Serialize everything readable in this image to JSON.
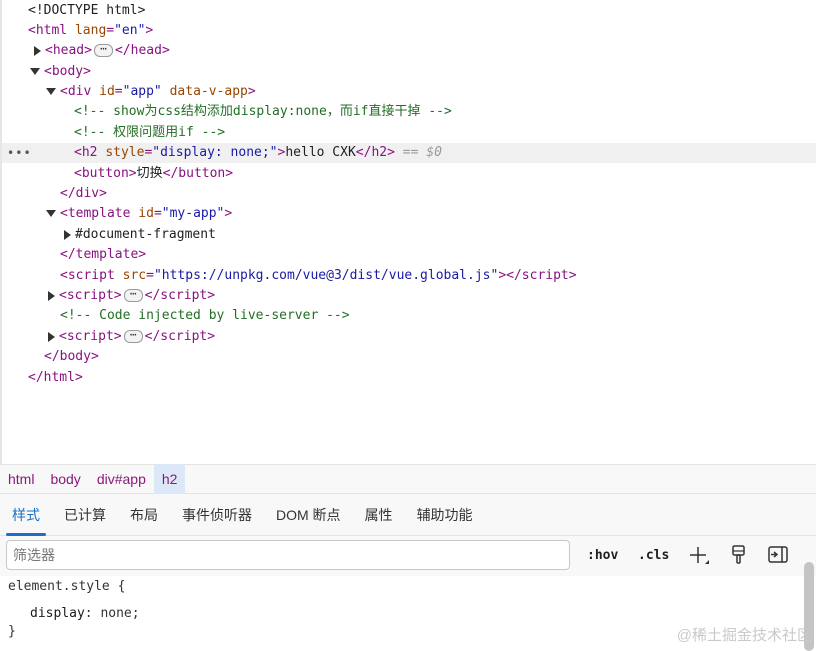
{
  "dom_tree": {
    "doctype": "<!DOCTYPE html>",
    "html_open_tag": "html",
    "html_lang_attr": "lang",
    "html_lang_val": "\"en\"",
    "head_tag": "head",
    "body_tag": "body",
    "div_tag": "div",
    "div_id_attr": "id",
    "div_id_val": "\"app\"",
    "div_extra_attr": "data-v-app",
    "comment1": "<!-- show为css结构添加display:none，而if直接干掉 -->",
    "comment2": "<!-- 权限问题用if -->",
    "h2_tag": "h2",
    "h2_style_attr": "style",
    "h2_style_val": "\"display: none;\"",
    "h2_text": "hello CXK",
    "h2_ref": "== $0",
    "button_tag": "button",
    "button_text": "切换",
    "template_tag": "template",
    "template_id_attr": "id",
    "template_id_val": "\"my-app\"",
    "fragment_text": "#document-fragment",
    "script_tag": "script",
    "script_src_attr": "src",
    "script_src_val": "\"https://unpkg.com/vue@3/dist/vue.global.js\"",
    "comment3": "<!-- Code injected by live-server -->",
    "ellipsis": "⋯",
    "row_dots": "•••"
  },
  "breadcrumb": {
    "items": [
      "html",
      "body",
      "div#app",
      "h2"
    ]
  },
  "panel_tabs": [
    "样式",
    "已计算",
    "布局",
    "事件侦听器",
    "DOM 断点",
    "属性",
    "辅助功能"
  ],
  "filter": {
    "placeholder": "筛选器",
    "hov_label": ":hov",
    "cls_label": ".cls"
  },
  "styles_pane": {
    "selector": "element.style {",
    "property": "display",
    "value": "none",
    "close": "}"
  },
  "watermark": "@稀土掘金技术社区",
  "icons": [
    "expand-triangle-icon",
    "collapse-triangle-icon",
    "add-rule-icon",
    "paint-brush-icon",
    "toggle-sidebar-icon"
  ],
  "colors": {
    "tag": "#881280",
    "attribute": "#994500",
    "value": "#1a1aa6",
    "comment": "#236e25",
    "accent": "#1a6fc9"
  }
}
